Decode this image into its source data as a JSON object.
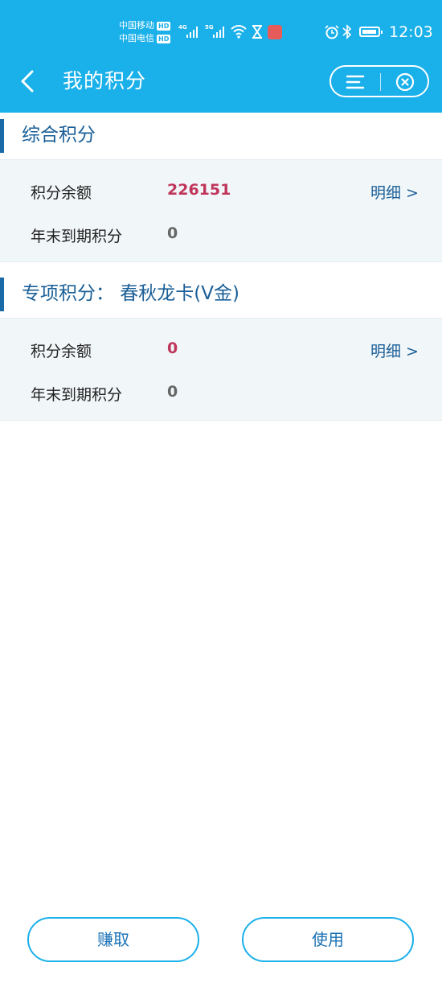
{
  "status_bar": {
    "carrier1": "中国移动",
    "carrier2": "中国电信",
    "hd": "HD",
    "net1": "4G",
    "net2": "5G",
    "time": "12:03"
  },
  "nav": {
    "title": "我的积分",
    "back_icon": "chevron-left-icon",
    "menu_icon": "menu-icon",
    "close_icon": "close-circle-icon"
  },
  "sections": [
    {
      "title": "综合积分",
      "rows": [
        {
          "label": "积分余额",
          "value": "226151",
          "link": "明细 >"
        },
        {
          "label": "年末到期积分",
          "value": "0"
        }
      ]
    },
    {
      "title": "专项积分： 春秋龙卡(V金)",
      "rows": [
        {
          "label": "积分余额",
          "value": "0",
          "link": "明细 >"
        },
        {
          "label": "年末到期积分",
          "value": "0"
        }
      ]
    }
  ],
  "actions": {
    "earn": "赚取",
    "use": "使用"
  },
  "colors": {
    "header_bg": "#1ab0ea",
    "accent_text": "#1a5f97",
    "value_red": "#c0365b"
  }
}
